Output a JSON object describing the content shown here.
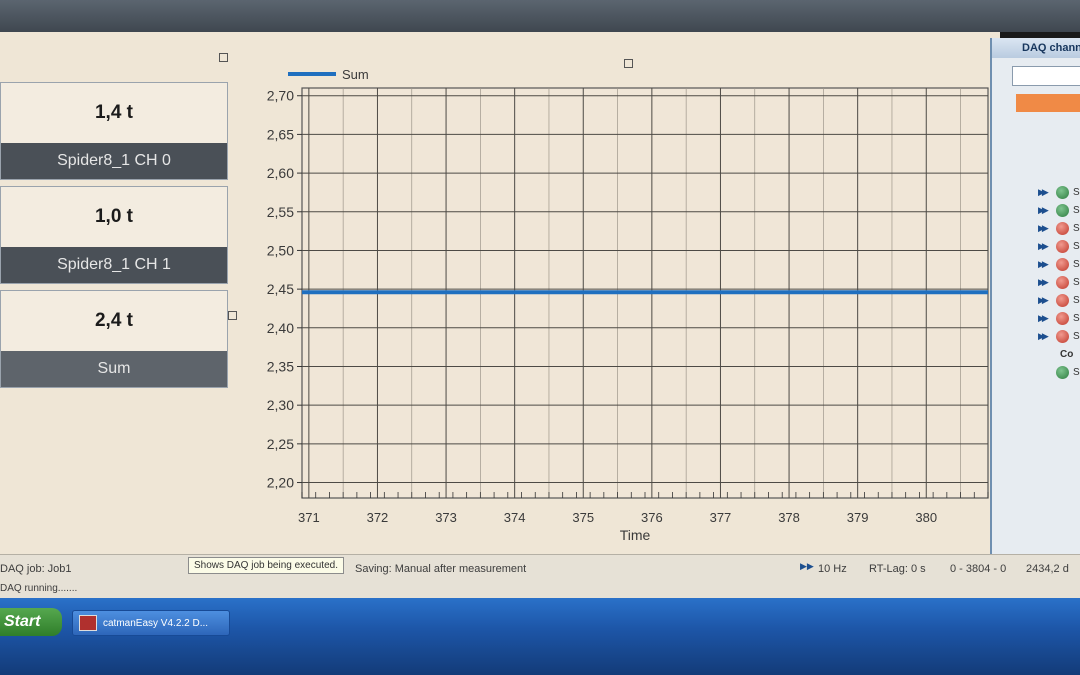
{
  "values": [
    {
      "value": "1,4 t",
      "name": "Spider8_1 CH 0"
    },
    {
      "value": "1,0 t",
      "name": "Spider8_1 CH 1"
    },
    {
      "value": "2,4 t",
      "name": "Sum"
    }
  ],
  "chart_data": {
    "type": "line",
    "xlabel": "Time",
    "ylabel": "",
    "xlim": [
      370.9,
      380.9
    ],
    "ylim": [
      2.18,
      2.71
    ],
    "xticks": [
      371,
      372,
      373,
      374,
      375,
      376,
      377,
      378,
      379,
      380
    ],
    "yticks": [
      2.2,
      2.25,
      2.3,
      2.35,
      2.4,
      2.45,
      2.5,
      2.55,
      2.6,
      2.65,
      2.7
    ],
    "decimal_comma": true,
    "grid": true,
    "legend": "top-left",
    "series": [
      {
        "name": "Sum",
        "color": "#1f6fbf",
        "x": [
          370.9,
          380.9
        ],
        "y": [
          2.446,
          2.446
        ]
      }
    ]
  },
  "side_panel": {
    "title": "DAQ channels",
    "rows": [
      {
        "status": "green",
        "text": "Sp"
      },
      {
        "status": "green",
        "text": "Sp"
      },
      {
        "status": "red",
        "text": "Sp"
      },
      {
        "status": "red",
        "text": "Sp"
      },
      {
        "status": "red",
        "text": "Sp"
      },
      {
        "status": "red",
        "text": "Sp"
      },
      {
        "status": "red",
        "text": "Sp"
      },
      {
        "status": "red",
        "text": "Sp"
      },
      {
        "status": "red",
        "text": "Sp"
      }
    ],
    "computed_label": "Co",
    "sum_label": "Su"
  },
  "status": {
    "job": "DAQ job: Job1",
    "saving": "Saving: Manual after measurement",
    "rate": "10 Hz",
    "rt_lag": "RT-Lag: 0 s",
    "range": "0 - 3804 - 0",
    "clock": "2434,2 d",
    "running": "DAQ running.......",
    "tooltip": "Shows DAQ job being executed."
  },
  "taskbar": {
    "start": "Start",
    "item": "catmanEasy V4.2.2 D..."
  },
  "icons": {
    "search": "magnifier-icon",
    "forward": "double-arrow-icon",
    "status_ok": "green-status-icon",
    "status_err": "red-status-icon"
  }
}
